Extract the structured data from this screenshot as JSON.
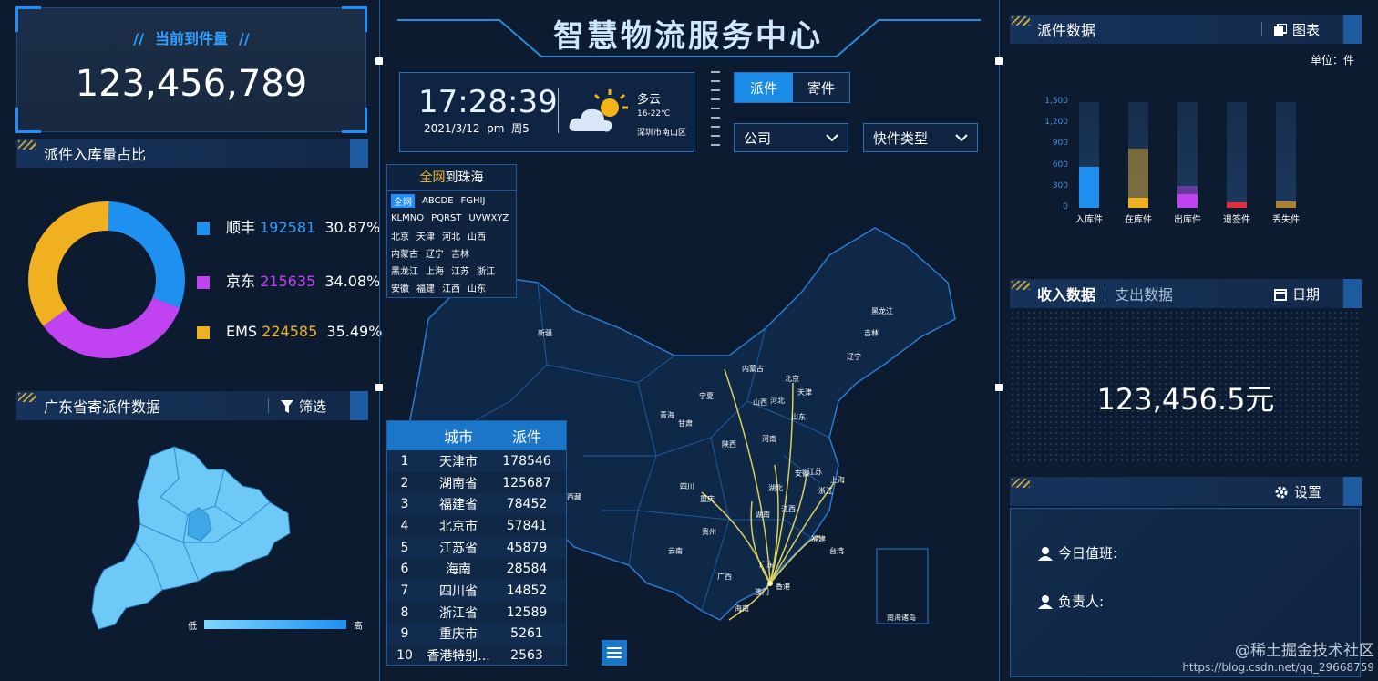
{
  "header": {
    "title": "智慧物流服务中心"
  },
  "current_count": {
    "label": "当前到件量",
    "value": "123,456,789"
  },
  "pie_panel": {
    "title": "派件入库量占比"
  },
  "pie": {
    "legend": [
      {
        "name": "顺丰",
        "count": "192581",
        "percent": "30.87%",
        "color": "#1e90f0"
      },
      {
        "name": "京东",
        "count": "215635",
        "percent": "34.08%",
        "color": "#c142f0"
      },
      {
        "name": "EMS",
        "count": "224585",
        "percent": "35.49%",
        "color": "#f0b020"
      }
    ]
  },
  "guangdong_panel": {
    "title": "广东省寄派件数据",
    "filter_label": "筛选",
    "legend_low": "低",
    "legend_high": "高"
  },
  "clock": {
    "time": "17:28:39",
    "date": "2021/3/12  pm  周5",
    "weather": "多云",
    "temp": "16-22℃",
    "location": "深圳市南山区"
  },
  "tabs": {
    "send": "派件",
    "receive": "寄件"
  },
  "selects": {
    "company": "公司",
    "express_type": "快件类型"
  },
  "filter_box": {
    "title_highlight": "全网",
    "title_rest": "到珠海",
    "rows": [
      [
        "全网",
        "ABCDE",
        "FGHIJ"
      ],
      [
        "KLMNO",
        "PQRST",
        "UVWXYZ"
      ],
      [
        "北京",
        "天津",
        "河北",
        "山西"
      ],
      [
        "内蒙古",
        "辽宁",
        "吉林"
      ],
      [
        "黑龙江",
        "上海",
        "江苏",
        "浙江"
      ],
      [
        "安徽",
        "福建",
        "江西",
        "山东"
      ]
    ]
  },
  "city_table": {
    "headers": [
      "城市",
      "派件"
    ],
    "rows": [
      [
        "1",
        "天津市",
        "178546"
      ],
      [
        "2",
        "湖南省",
        "125687"
      ],
      [
        "3",
        "福建省",
        "78452"
      ],
      [
        "4",
        "北京市",
        "57841"
      ],
      [
        "5",
        "江苏省",
        "45879"
      ],
      [
        "6",
        "海南",
        "28584"
      ],
      [
        "7",
        "四川省",
        "14852"
      ],
      [
        "8",
        "浙江省",
        "12589"
      ],
      [
        "9",
        "重庆市",
        "5261"
      ],
      [
        "10",
        "香港特别...",
        "2563"
      ]
    ]
  },
  "map_labels": [
    "新疆",
    "西藏",
    "青海",
    "甘肃",
    "宁夏",
    "内蒙古",
    "黑龙江",
    "吉林",
    "辽宁",
    "北京",
    "天津",
    "山西",
    "河北",
    "山东",
    "陕西",
    "河南",
    "四川",
    "重庆",
    "湖北",
    "安徽",
    "江苏",
    "上海",
    "浙江",
    "湖南",
    "江西",
    "贵州",
    "云南",
    "广西",
    "广东",
    "福建",
    "台湾",
    "香港",
    "澳门",
    "海南",
    "南海诸岛"
  ],
  "parcel_panel": {
    "title": "派件数据",
    "chart_label": "图表",
    "unit": "单位：件"
  },
  "chart_data": {
    "type": "bar",
    "categories": [
      "入库件",
      "在库件",
      "出库件",
      "退签件",
      "丢失件"
    ],
    "series": [
      {
        "values": [
          580,
          140,
          200,
          80,
          90
        ],
        "colors": [
          "#1e90f0",
          "#f0b020",
          "#c142f0",
          "#e03040",
          "#b08030"
        ]
      },
      {
        "values": [
          0,
          840,
          310,
          0,
          0
        ]
      }
    ],
    "ylim": [
      0,
      1500
    ],
    "yticks": [
      "0",
      "300",
      "600",
      "900",
      "1,200",
      "1,500"
    ]
  },
  "income_panel": {
    "tab_active": "收入数据",
    "tab_inactive": "支出数据",
    "date_label": "日期",
    "value": "123,456.5元"
  },
  "settings_panel": {
    "label": "设置",
    "duty_label": "今日值班:",
    "owner_label": "负责人:"
  },
  "watermark": {
    "line1": "@稀土掘金技术社区",
    "line2": "https://blog.csdn.net/qq_29668759"
  }
}
